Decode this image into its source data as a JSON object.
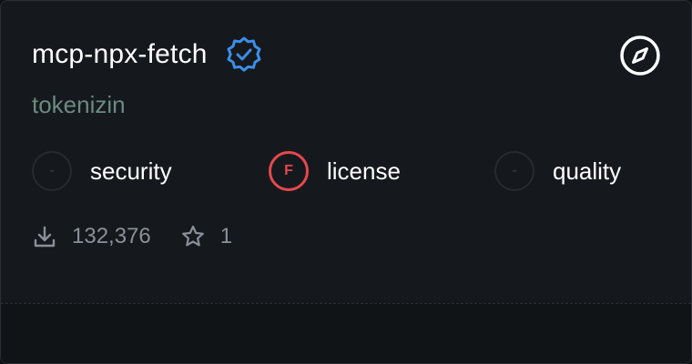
{
  "package": {
    "name": "mcp-npx-fetch",
    "author": "tokenizin",
    "verified_icon": "verified-badge-icon",
    "explore_icon": "compass-icon"
  },
  "scores": [
    {
      "grade": "-",
      "label": "security",
      "status": "none"
    },
    {
      "grade": "F",
      "label": "license",
      "status": "fail"
    },
    {
      "grade": "-",
      "label": "quality",
      "status": "none"
    }
  ],
  "stats": {
    "downloads": "132,376",
    "stars": "1"
  },
  "colors": {
    "background": "#15191d",
    "verified": "#3b8eea",
    "fail": "#e5484d",
    "author": "#6b8a80"
  }
}
